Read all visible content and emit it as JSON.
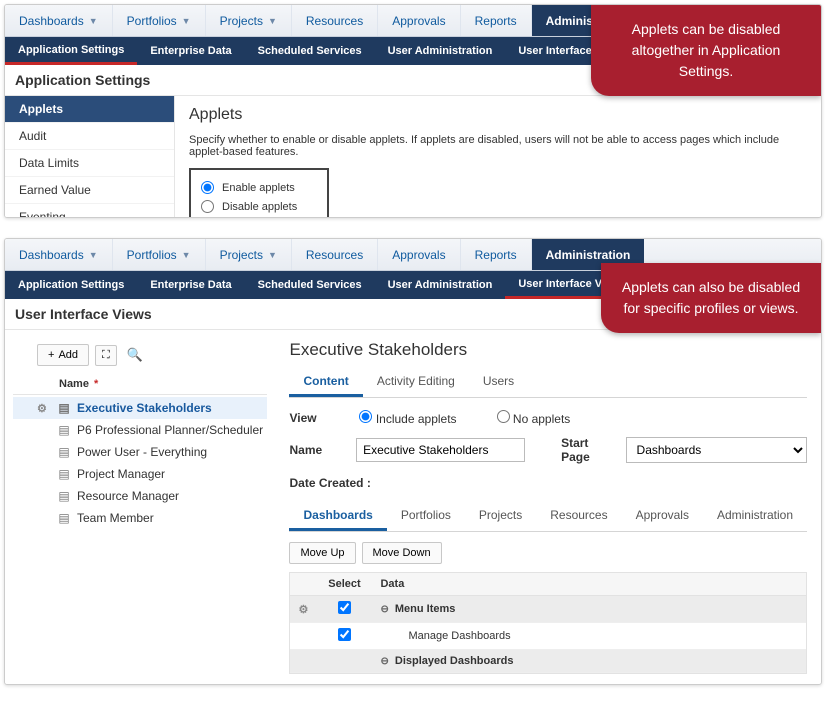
{
  "nav": {
    "tabs": [
      "Dashboards",
      "Portfolios",
      "Projects",
      "Resources",
      "Approvals",
      "Reports",
      "Administration"
    ],
    "active": "Administration",
    "dropdowns": [
      true,
      true,
      true,
      false,
      false,
      false,
      false
    ]
  },
  "subnav1": {
    "items": [
      "Application Settings",
      "Enterprise Data",
      "Scheduled Services",
      "User Administration",
      "User Interface Views"
    ],
    "active": "Application Settings"
  },
  "subnav2": {
    "items": [
      "Application Settings",
      "Enterprise Data",
      "Scheduled Services",
      "User Administration",
      "User Interface Views"
    ],
    "active": "User Interface Views"
  },
  "panel1": {
    "section_title": "Application Settings",
    "sidebar": [
      "Applets",
      "Audit",
      "Data Limits",
      "Earned Value",
      "Eventing"
    ],
    "sidebar_selected": "Applets",
    "heading": "Applets",
    "description": "Specify whether to enable or disable applets. If applets are disabled, users will not be able to access pages which include applet-based features.",
    "radio_enable": "Enable applets",
    "radio_disable": "Disable applets",
    "radio_selected": "enable"
  },
  "panel2": {
    "section_title": "User Interface Views",
    "toolbar": {
      "add": "Add"
    },
    "tree_header": "Name",
    "tree_items": [
      "Executive Stakeholders",
      "P6 Professional Planner/Scheduler",
      "Power User - Everything",
      "Project Manager",
      "Resource Manager",
      "Team Member"
    ],
    "tree_selected": "Executive Stakeholders",
    "detail": {
      "title": "Executive Stakeholders",
      "tabs": [
        "Content",
        "Activity Editing",
        "Users"
      ],
      "tab_active": "Content",
      "view_label": "View",
      "view_include": "Include applets",
      "view_no": "No applets",
      "view_selected": "include",
      "name_label": "Name",
      "name_value": "Executive Stakeholders",
      "startpage_label": "Start Page",
      "startpage_value": "Dashboards",
      "date_created_label": "Date Created :",
      "mini_tabs": [
        "Dashboards",
        "Portfolios",
        "Projects",
        "Resources",
        "Approvals",
        "Administration"
      ],
      "mini_tab_active": "Dashboards",
      "move_up": "Move Up",
      "move_down": "Move Down",
      "grid": {
        "col_select": "Select",
        "col_data": "Data",
        "rows": [
          {
            "type": "group",
            "label": "Menu Items",
            "checked": true,
            "gear": true
          },
          {
            "type": "item",
            "label": "Manage Dashboards",
            "checked": true,
            "gear": false
          },
          {
            "type": "group",
            "label": "Displayed Dashboards",
            "checked": null,
            "gear": false
          }
        ]
      }
    }
  },
  "callout1": "Applets can be disabled altogether in Application Settings.",
  "callout2": "Applets can also be disabled for specific profiles or views."
}
